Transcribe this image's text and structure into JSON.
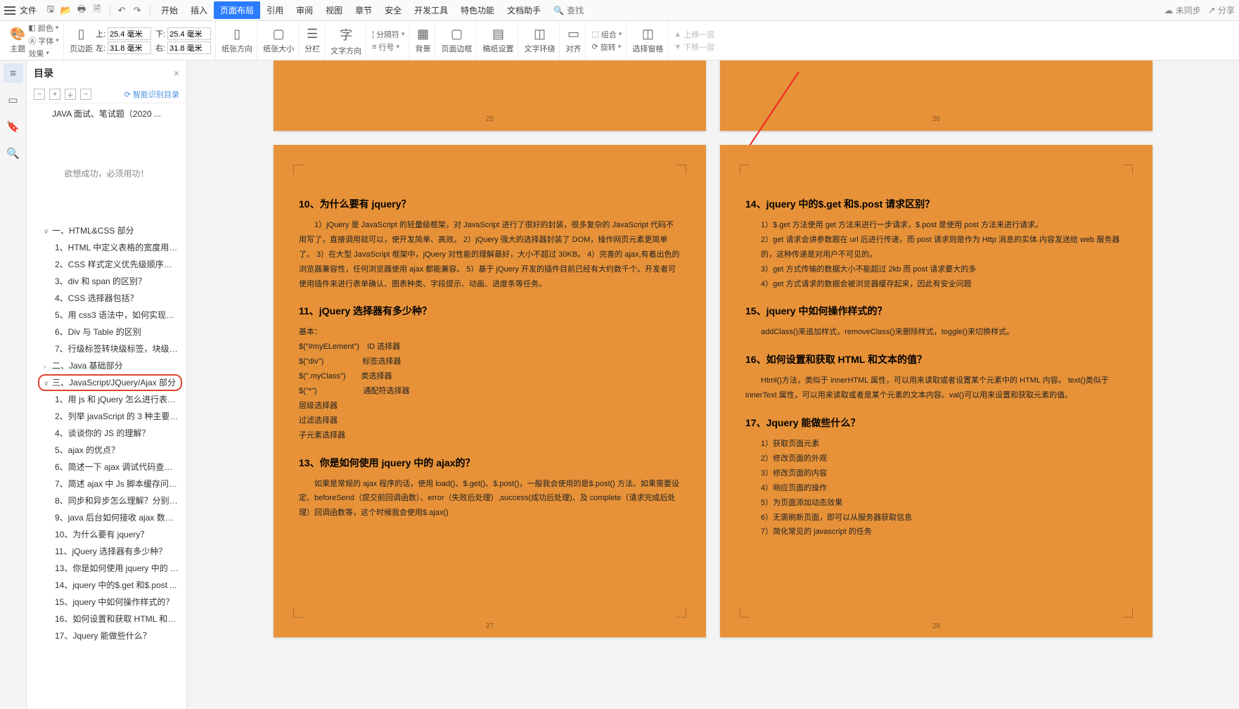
{
  "menubar": {
    "file": "文件",
    "tabs": [
      "开始",
      "插入",
      "页面布局",
      "引用",
      "审阅",
      "视图",
      "章节",
      "安全",
      "开发工具",
      "特色功能",
      "文档助手"
    ],
    "active_tab": 2,
    "search": "查找",
    "unsynced": "未同步",
    "share": "分享"
  },
  "ribbon": {
    "theme": "主题",
    "color_label": "颜色",
    "font_label": "字体",
    "effect_label": "效果",
    "margin": "页边距",
    "margin_vals": {
      "top_l": "上:",
      "top_v": "25.4 毫米",
      "bottom_l": "下:",
      "bottom_v": "25.4 毫米",
      "left_l": "左:",
      "left_v": "31.8 毫米",
      "right_l": "右:",
      "right_v": "31.8 毫米"
    },
    "orientation": "纸张方向",
    "size": "纸张大小",
    "columns": "分栏",
    "textdir": "文字方向",
    "linenum": "行号",
    "hyphen": "分隔符",
    "bg": "背景",
    "border": "页面边框",
    "manuscript": "稿纸设置",
    "wrap": "文字环绕",
    "align": "对齐",
    "group": "组合",
    "rotate": "旋转",
    "pane": "选择窗格",
    "moveup": "上移一层",
    "movedown": "下移一层"
  },
  "rail": {
    "items": [
      "≡",
      "▭",
      "🔖",
      "🔍"
    ]
  },
  "toc": {
    "title": "目录",
    "smart": "智能识别目录",
    "doc_title": "JAVA 面试、笔试题（2020 ...",
    "motto": "欲想成功，必须用功！",
    "items": [
      {
        "l": 1,
        "t": "一、HTML&CSS 部分",
        "exp": "∨"
      },
      {
        "l": 2,
        "t": "1、HTML 中定义表格的宽度用 8..."
      },
      {
        "l": 2,
        "t": "2、CSS 样式定义优先级顺序是？"
      },
      {
        "l": 2,
        "t": "3、div 和 span 的区别？"
      },
      {
        "l": 2,
        "t": "4、CSS 选择器包括？"
      },
      {
        "l": 2,
        "t": "5、用 css3 语法中，如何实现一..."
      },
      {
        "l": 2,
        "t": "6、Div 与 Table 的区别"
      },
      {
        "l": 2,
        "t": "7、行级标签转块级标签，块级标..."
      },
      {
        "l": 1,
        "t": "二、Java 基础部分",
        "exp": "›"
      },
      {
        "l": 1,
        "t": "三、JavaScript/JQuery/Ajax 部分",
        "hl": true,
        "exp": "∨"
      },
      {
        "l": 2,
        "t": "1、用 js 和 jQuery 怎么进行表单..."
      },
      {
        "l": 2,
        "t": "2、列举 javaScript 的 3 种主要数..."
      },
      {
        "l": 2,
        "t": "4、谈谈你的 JS 的理解？"
      },
      {
        "l": 2,
        "t": "5、ajax 的优点？"
      },
      {
        "l": 2,
        "t": "6、简述一下 ajax 调试代码查找..."
      },
      {
        "l": 2,
        "t": "7、简述 ajax 中 Js 脚本缓存问题..."
      },
      {
        "l": 2,
        "t": "8、同步和异步怎么理解？分别在..."
      },
      {
        "l": 2,
        "t": "9、java 后台如何接收 ajax 数据..."
      },
      {
        "l": 2,
        "t": "10、为什么要有 jquery？"
      },
      {
        "l": 2,
        "t": "11、jQuery 选择器有多少种？"
      },
      {
        "l": 2,
        "t": "13、你是如何使用 jquery 中的 aj..."
      },
      {
        "l": 2,
        "t": "14、jquery 中的$.get 和$.post ..."
      },
      {
        "l": 2,
        "t": "15、jquery 中如何操作样式的？"
      },
      {
        "l": 2,
        "t": "16、如何设置和获取 HTML 和文..."
      },
      {
        "l": 2,
        "t": "17、Jquery 能做些什么？"
      }
    ]
  },
  "pages": {
    "top_left_num": "25",
    "top_right_num": "26",
    "left_num": "27",
    "right_num": "28",
    "left": {
      "h10": "10、为什么要有 jquery？",
      "p10": "1）jQuery 是 JavaScript 的轻量级框架，对 JavaScript 进行了很好的封装，很多复杂的 JavaScript 代码不用写了，直接调用就可以，使开发简单、高效。\n2）jQuery 强大的选择器封装了 DOM，操作网页元素更简单了。\n3）在大型 JavaScript 框架中，jQuery 对性能的理解最好，大小不超过 30KB。\n4）完善的 ajax,有着出色的浏览器兼容性，任何浏览器使用 ajax 都能兼容。\n5）基于 jQuery 开发的插件目前已经有大约数千个。开发者可使用插件来进行表单确认、图表种类、字段提示、动画、进度条等任务。",
      "h11": "11、jQuery 选择器有多少种？",
      "p11_rows": [
        "基本：",
        "$(\"#myELement\")　ID 选择器",
        "$(\"div\")　　　　　标签选择器",
        "$(\".myClass\")　　类选择器",
        "$(\"*\")　　　　　　通配符选择器",
        "层级选择器",
        "过滤选择器",
        "子元素选择器"
      ],
      "h13": "13、你是如何使用 jquery 中的 ajax的？",
      "p13": "如果是常规的 ajax 程序的话，使用 load()、$.get()、$.post()，一般我会使用的是$.post() 方法。如果需要设定、beforeSend（提交前回调函数）、error（失败后处理）,success(成功后处理)、及 complete（请求完成后处理）回调函数等，这个时候我会使用$.ajax()"
    },
    "right": {
      "h14": "14、jquery 中的$.get 和$.post 请求区别？",
      "p14": [
        "1）$.get 方法使用 get 方法来进行一步请求，$.post 是使用 post 方法来进行请求。",
        "2）get 请求会讲参数跟在 url 后进行传递，而 post 请求则是作为 Http 消息的实体.内容发送给 web 服务器的，这种传递是对用户不可见的。",
        "3）get 方式传输的数据大小不能超过 2kb 而 post 请求要大的多",
        "4）get 方式请求的数据会被浏览器缓存起来，因此有安全问题"
      ],
      "h15": "15、jquery 中如何操作样式的？",
      "p15": "addClass()来追加样式，removeClass()来删除样式，toggle()来切换样式。",
      "h16": "16、如何设置和获取 HTML 和文本的值？",
      "p16": "Html()方法，类似于 innerHTML 属性，可以用来读取或者设置某个元素中的 HTML 内容。 text()类似于 innerText 属性，可以用来读取或者是某个元素的文本内容。val()可以用来设置和获取元素的值。",
      "h17": "17、Jquery 能做些什么？",
      "p17": [
        "1）获取页面元素",
        "2）修改页面的外观",
        "3）修改页面的内容",
        "4）响应页面的操作",
        "5）为页面添加动态效果",
        "6）无需刷新页面，即可以从服务器获取信息",
        "7）简化常见的 javascript 的任务"
      ]
    }
  }
}
